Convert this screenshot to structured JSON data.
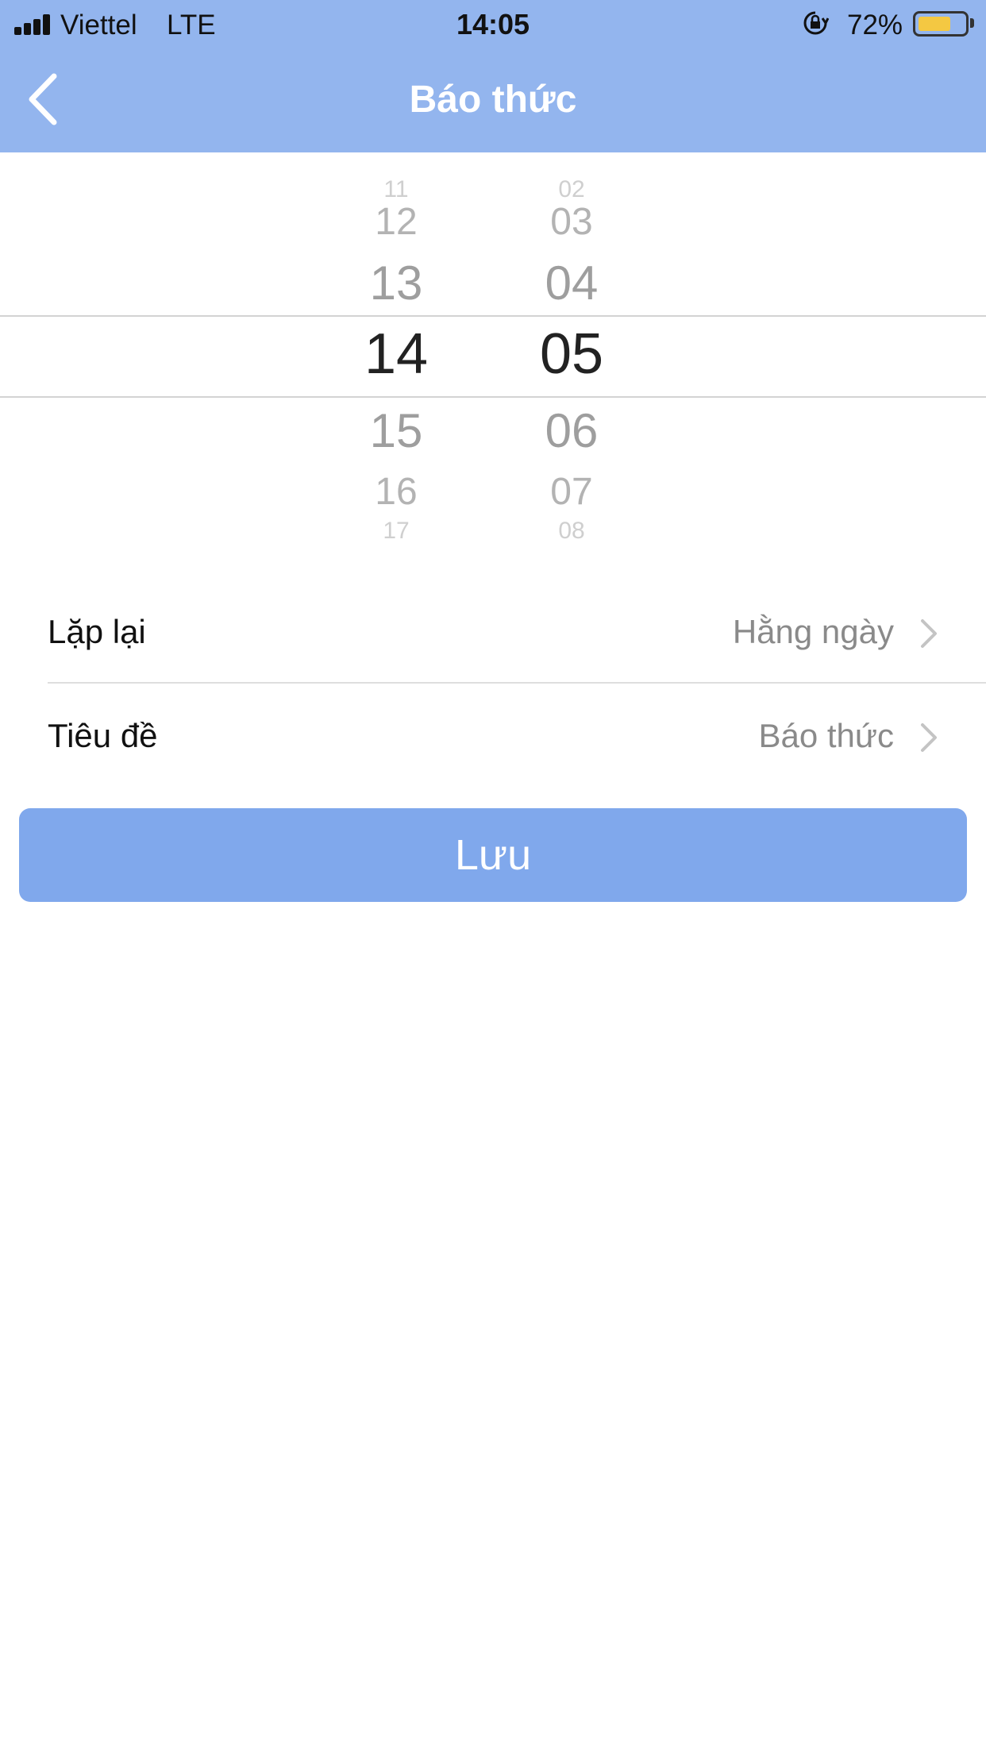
{
  "status_bar": {
    "carrier": "Viettel",
    "network": "LTE",
    "time": "14:05",
    "battery_percent": "72%",
    "battery_level": 0.72,
    "icons": [
      "signal-icon",
      "orientation-lock-icon",
      "battery-icon"
    ]
  },
  "nav": {
    "title": "Báo thức",
    "back_icon": "chevron-left-icon"
  },
  "picker": {
    "hours": [
      "11",
      "12",
      "13",
      "14",
      "15",
      "16",
      "17"
    ],
    "minutes": [
      "02",
      "03",
      "04",
      "05",
      "06",
      "07",
      "08"
    ],
    "selected_hour": "14",
    "selected_minute": "05"
  },
  "settings": {
    "repeat": {
      "label": "Lặp lại",
      "value": "Hằng ngày"
    },
    "title": {
      "label": "Tiêu đề",
      "value": "Báo thức"
    }
  },
  "save_button": {
    "label": "Lưu"
  },
  "colors": {
    "header": "#93b5ee",
    "button": "#80a8ec",
    "divider": "#dedede"
  }
}
